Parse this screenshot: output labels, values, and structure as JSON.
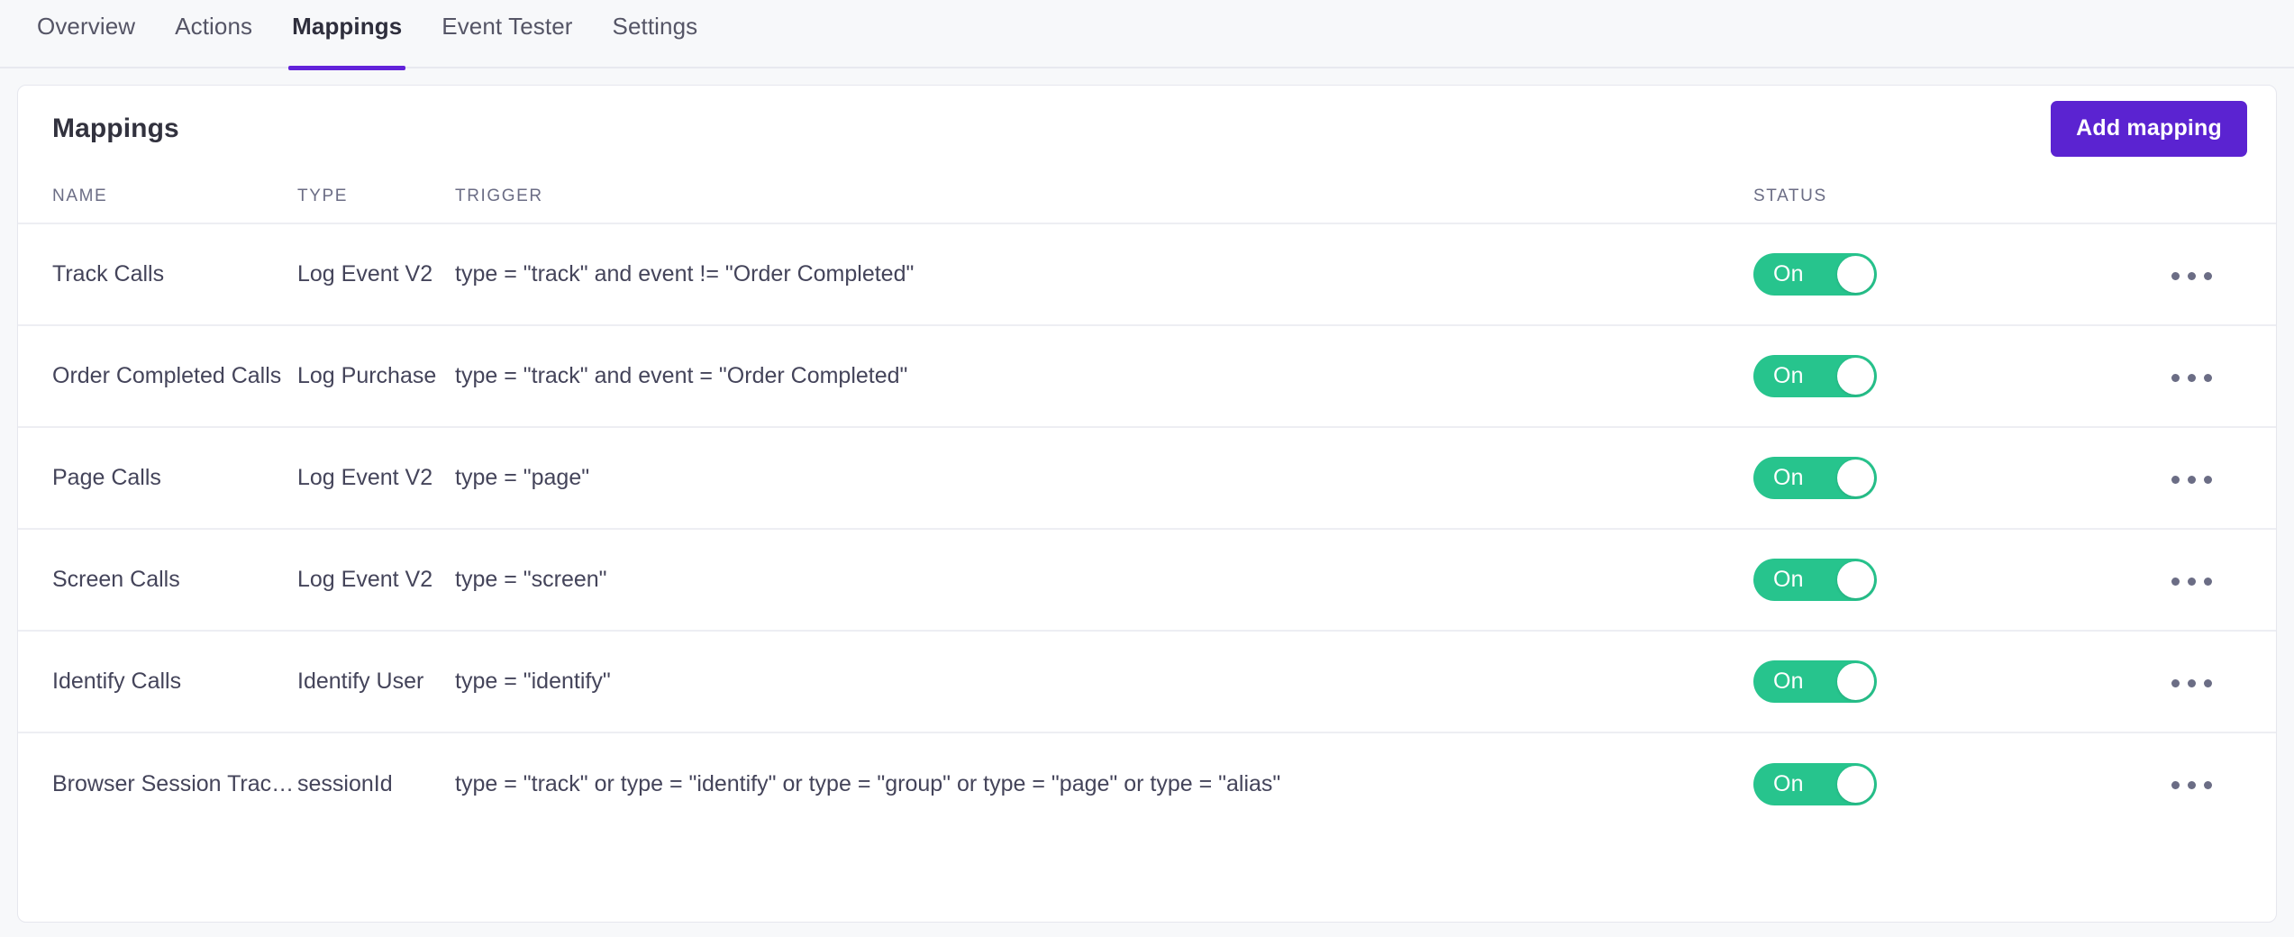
{
  "tabs": [
    {
      "label": "Overview",
      "active": false
    },
    {
      "label": "Actions",
      "active": false
    },
    {
      "label": "Mappings",
      "active": true
    },
    {
      "label": "Event Tester",
      "active": false
    },
    {
      "label": "Settings",
      "active": false
    }
  ],
  "card": {
    "title": "Mappings",
    "add_button_label": "Add mapping"
  },
  "table": {
    "headers": {
      "name": "NAME",
      "type": "TYPE",
      "trigger": "TRIGGER",
      "status": "STATUS"
    },
    "rows": [
      {
        "name": "Track Calls",
        "type": "Log Event V2",
        "trigger": "type = \"track\" and event != \"Order Completed\"",
        "status": "On",
        "enabled": true
      },
      {
        "name": "Order Completed Calls",
        "type": "Log Purchase",
        "trigger": "type = \"track\" and event = \"Order Completed\"",
        "status": "On",
        "enabled": true
      },
      {
        "name": "Page Calls",
        "type": "Log Event V2",
        "trigger": "type = \"page\"",
        "status": "On",
        "enabled": true
      },
      {
        "name": "Screen Calls",
        "type": "Log Event V2",
        "trigger": "type = \"screen\"",
        "status": "On",
        "enabled": true
      },
      {
        "name": "Identify Calls",
        "type": "Identify User",
        "trigger": "type = \"identify\"",
        "status": "On",
        "enabled": true
      },
      {
        "name": "Browser Session Tracking",
        "type": "sessionId",
        "trigger": "type = \"track\" or type = \"identify\" or type = \"group\" or type = \"page\" or type = \"alias\"",
        "status": "On",
        "enabled": true
      }
    ]
  },
  "colors": {
    "accent": "#5B23D1",
    "tab_underline": "#6222DA",
    "toggle_on": "#27C48D",
    "page_bg": "#F7F8FA",
    "card_bg": "#FFFFFF",
    "text_primary": "#32323E",
    "text_secondary": "#6B6D85"
  }
}
